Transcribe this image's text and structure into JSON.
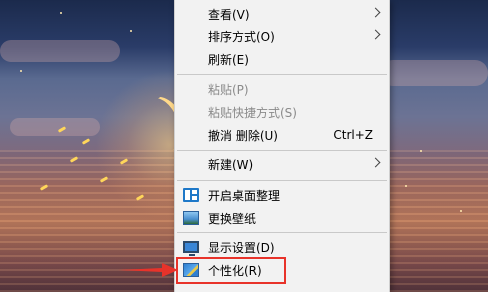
{
  "context_menu": {
    "items": [
      {
        "label": "查看(V)",
        "submenu": true,
        "disabled": false
      },
      {
        "label": "排序方式(O)",
        "submenu": true,
        "disabled": false
      },
      {
        "label": "刷新(E)",
        "submenu": false,
        "disabled": false
      },
      {
        "label": "粘贴(P)",
        "submenu": false,
        "disabled": true
      },
      {
        "label": "粘贴快捷方式(S)",
        "submenu": false,
        "disabled": true
      },
      {
        "label": "撤消 删除(U)",
        "shortcut": "Ctrl+Z",
        "submenu": false,
        "disabled": false
      },
      {
        "label": "新建(W)",
        "submenu": true,
        "disabled": false
      },
      {
        "label": "开启桌面整理",
        "icon": "desktop-organize-icon",
        "submenu": false,
        "disabled": false
      },
      {
        "label": "更换壁纸",
        "icon": "wallpaper-icon",
        "submenu": false,
        "disabled": false
      },
      {
        "label": "显示设置(D)",
        "icon": "display-settings-icon",
        "submenu": false,
        "disabled": false
      },
      {
        "label": "个性化(R)",
        "icon": "personalize-icon",
        "submenu": false,
        "disabled": false
      }
    ]
  },
  "annotation": {
    "highlighted_item": "个性化(R)",
    "color": "#e8332a"
  },
  "colors": {
    "menu_background": "#f2f2f2",
    "disabled_text": "#8a8a8a"
  }
}
